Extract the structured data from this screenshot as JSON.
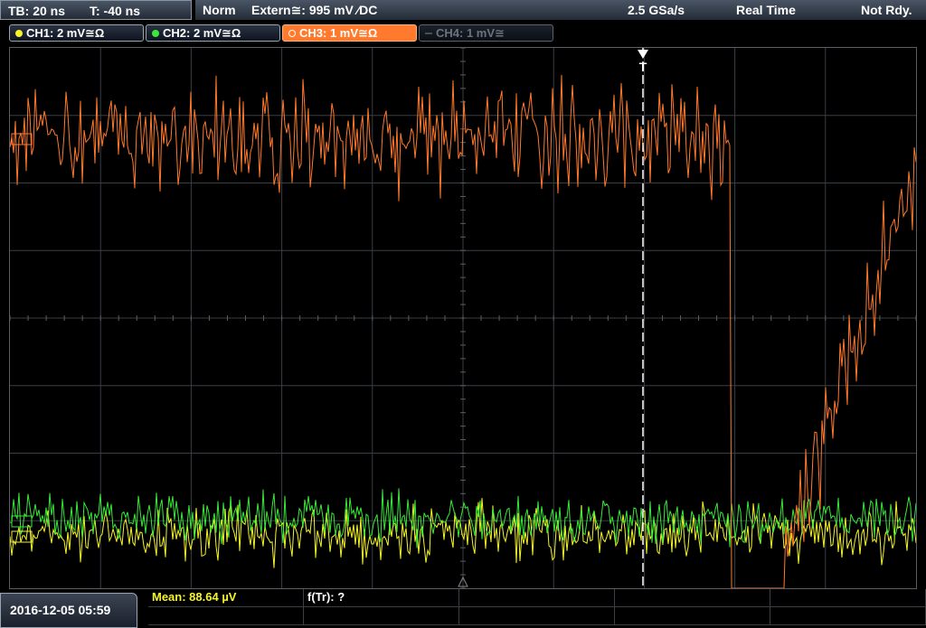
{
  "status_bar": {
    "timebase": "TB: 20 ns",
    "trigger_offset": "T: -40 ns",
    "trigger_mode": "Norm",
    "trigger_source": "Extern≅: 995 mV ⁄DC",
    "sample_rate": "2.5 GSa/s",
    "acquisition_mode": "Real Time",
    "ready_state": "Not Rdy."
  },
  "channels": [
    {
      "label": "CH1: 2 mV≅Ω",
      "color": "#f5f52a",
      "state": "on"
    },
    {
      "label": "CH2: 2 mV≅Ω",
      "color": "#39e83a",
      "state": "on"
    },
    {
      "label": "CH3: 1 mV≅Ω",
      "color": "#ff7a2c",
      "state": "selected"
    },
    {
      "label": "CH4: 1 mV≅",
      "color": "#6d737c",
      "state": "off"
    }
  ],
  "trigger_marker": {
    "symbol": "T"
  },
  "measurements": {
    "mean": "Mean: 88.64 µV",
    "rise_time": "f(Tr): ?"
  },
  "datetime": "2016-12-05 05:59",
  "colors": {
    "ch1": "#f5f52a",
    "ch2": "#39e83a",
    "ch3": "#ff7a2c",
    "grid": "#3a3f46",
    "status_bar_bg": "#2e3744"
  }
}
